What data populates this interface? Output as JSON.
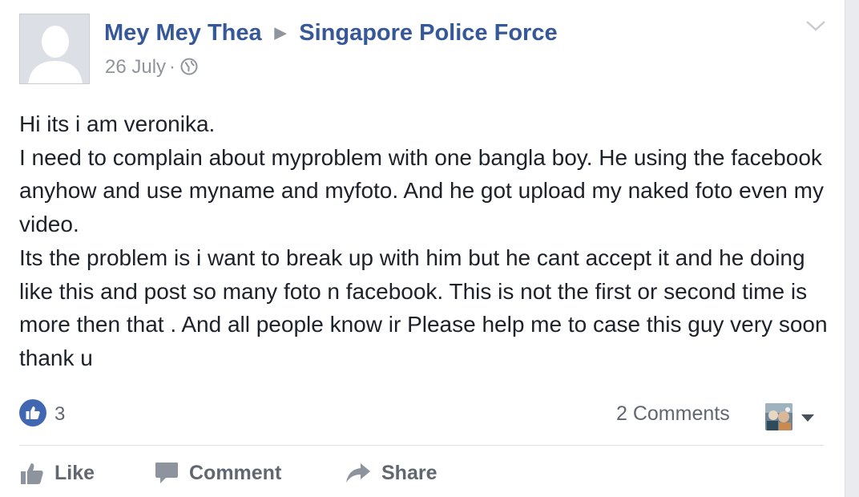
{
  "post": {
    "author": "Mey Mey Thea",
    "target": "Singapore Police Force",
    "date": "26 July",
    "privacy_icon": "globe-icon",
    "menu_icon": "chevron-down-icon",
    "body": [
      "Hi its i am veronika.",
      "I need to complain about myproblem with one bangla boy. He using the facebook anyhow and use myname and myfoto. And he got upload my naked foto even my video.",
      "Its the problem is i want to break up with him but he cant accept it and he doing like this and post so many foto n facebook. This is not the first or second time is more then that . And all people know ir Please help me to case this guy very soon thank u"
    ]
  },
  "reactions": {
    "like_count": "3",
    "comments_label": "2 Comments"
  },
  "actions": {
    "like": "Like",
    "comment": "Comment",
    "share": "Share"
  },
  "colors": {
    "link": "#365899",
    "meta": "#90949c",
    "like_badge": "#4267b2",
    "action_text": "#616770",
    "body_text": "#1d2129"
  }
}
